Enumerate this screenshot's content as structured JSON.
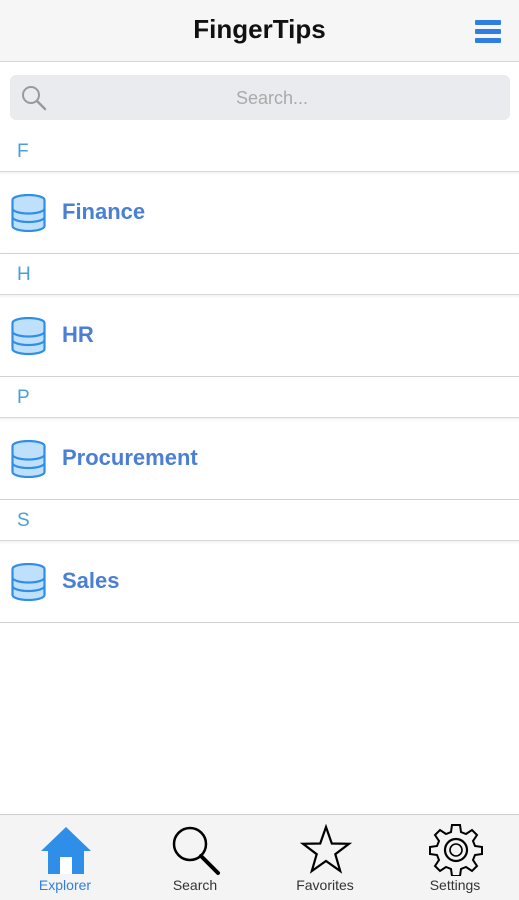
{
  "header": {
    "title": "FingerTips",
    "menu_icon": "hamburger-menu-icon",
    "accent_color": "#2f7fe0"
  },
  "search": {
    "placeholder": "Search...",
    "value": ""
  },
  "sections": [
    {
      "letter": "F",
      "items": [
        {
          "label": "Finance",
          "icon": "database-icon"
        }
      ]
    },
    {
      "letter": "H",
      "items": [
        {
          "label": "HR",
          "icon": "database-icon"
        }
      ]
    },
    {
      "letter": "P",
      "items": [
        {
          "label": "Procurement",
          "icon": "database-icon"
        }
      ]
    },
    {
      "letter": "S",
      "items": [
        {
          "label": "Sales",
          "icon": "database-icon"
        }
      ]
    }
  ],
  "tabbar": {
    "tabs": [
      {
        "label": "Explorer",
        "icon": "home-icon",
        "active": true
      },
      {
        "label": "Search",
        "icon": "search-icon",
        "active": false
      },
      {
        "label": "Favorites",
        "icon": "star-icon",
        "active": false
      },
      {
        "label": "Settings",
        "icon": "gear-icon",
        "active": false
      }
    ]
  }
}
